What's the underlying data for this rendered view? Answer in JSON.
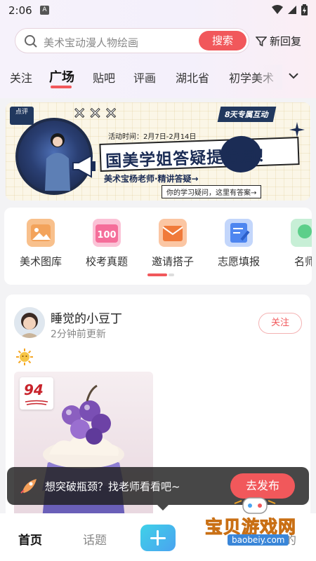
{
  "status_bar": {
    "time": "2:06",
    "notification_icon_letter": "A"
  },
  "search": {
    "placeholder": "美术宝动漫人物绘画",
    "button_label": "搜索"
  },
  "reply_filter": {
    "label": "新回复"
  },
  "tabs": [
    {
      "label": "关注",
      "active": false
    },
    {
      "label": "广场",
      "active": true
    },
    {
      "label": "贴吧",
      "active": false
    },
    {
      "label": "评画",
      "active": false
    },
    {
      "label": "湖北省",
      "active": false
    },
    {
      "label": "初学美术",
      "active": false
    }
  ],
  "banner": {
    "badge": "点评",
    "tag": "8天专属互动",
    "date_text": "活动时间：2月7日-2月14日",
    "headline": "国美学姐答疑提分局！",
    "subline": "美术宝杨老师·精讲答疑→",
    "footer": "你的学习疑问，这里有答案→"
  },
  "shortcuts": [
    {
      "label": "美术图库",
      "icon": "gallery-icon",
      "color": "#f3a35b"
    },
    {
      "label": "校考真题",
      "icon": "exam-100-icon",
      "color": "#f56e9a"
    },
    {
      "label": "邀请搭子",
      "icon": "invite-icon",
      "color": "#f07a3a"
    },
    {
      "label": "志愿填报",
      "icon": "form-icon",
      "color": "#4e86f0"
    },
    {
      "label": "名师",
      "icon": "teacher-icon",
      "color": "#5ccf8a"
    }
  ],
  "post": {
    "username": "睡觉的小豆丁",
    "time": "2分钟前更新",
    "follow_label": "关注",
    "emoji": "sun",
    "score": "94"
  },
  "toast": {
    "text": "想突破瓶颈？找老师看看吧~",
    "button_label": "去发布"
  },
  "bottom_nav": {
    "home": "首页",
    "topics": "话题",
    "mine": "我的"
  },
  "watermark": {
    "title": "宝贝游戏网",
    "url": "baobeiy.com"
  },
  "colors": {
    "accent": "#f1585b",
    "banner_navy": "#1b2c55"
  }
}
